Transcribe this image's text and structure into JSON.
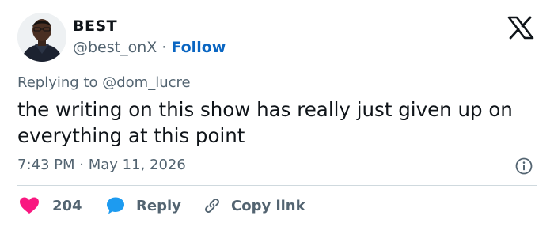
{
  "author": {
    "name": "BEST",
    "handle": "@best_onX",
    "separator": "·",
    "follow_label": "Follow"
  },
  "platform_icon": "x-logo-icon",
  "reply_context": {
    "prefix": "Replying to",
    "mention": "@dom_lucre"
  },
  "tweet_text": "the writing on this show has really just given up on everything at this point",
  "meta": {
    "time": "7:43 PM",
    "separator": "·",
    "date": "May 11, 2026",
    "info_icon": "info-icon"
  },
  "actions": {
    "like": {
      "icon": "heart-icon",
      "count": "204"
    },
    "reply": {
      "icon": "speech-bubble-icon",
      "label": "Reply"
    },
    "copy": {
      "icon": "link-icon",
      "label": "Copy link"
    }
  },
  "colors": {
    "text": "#0f1419",
    "secondary": "#536471",
    "follow": "#0a66c2",
    "like": "#f91880",
    "reply": "#1d9bf0",
    "divider": "#cfd9de"
  }
}
